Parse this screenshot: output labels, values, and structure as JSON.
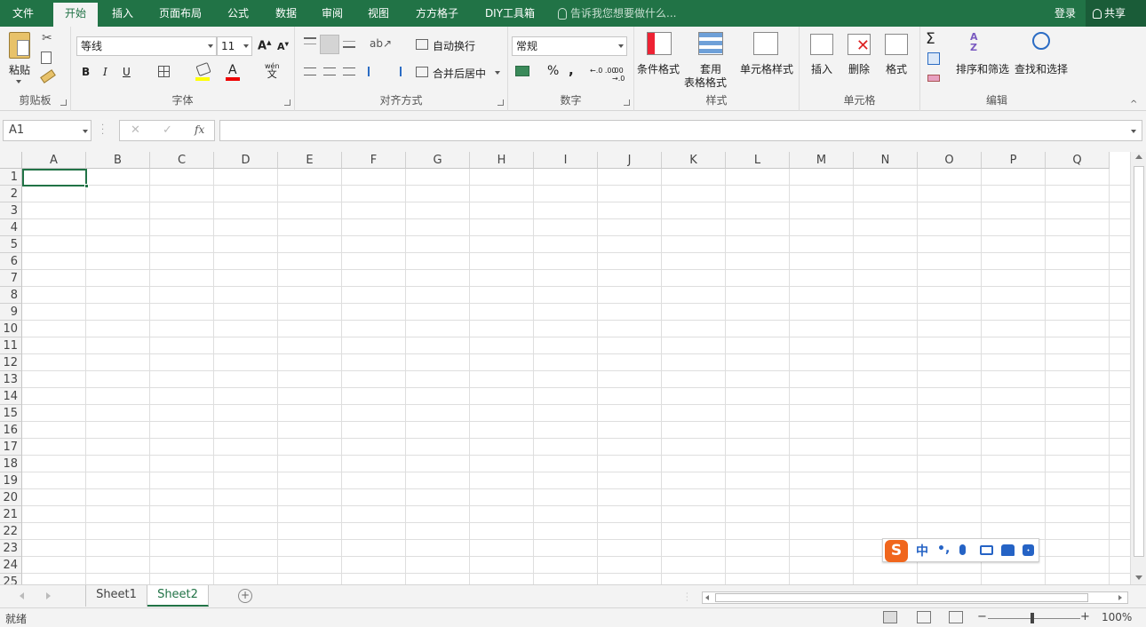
{
  "tabs": [
    {
      "label": "文件"
    },
    {
      "label": "开始"
    },
    {
      "label": "插入"
    },
    {
      "label": "页面布局"
    },
    {
      "label": "公式"
    },
    {
      "label": "数据"
    },
    {
      "label": "审阅"
    },
    {
      "label": "视图"
    },
    {
      "label": "方方格子"
    },
    {
      "label": "DIY工具箱"
    }
  ],
  "tellme": "告诉我您想要做什么...",
  "login": "登录",
  "share": "共享",
  "ribbon": {
    "clipboard": {
      "paste": "粘贴",
      "label": "剪贴板"
    },
    "font": {
      "name": "等线",
      "size": "11",
      "bold": "B",
      "italic": "I",
      "underline": "U",
      "label": "字体",
      "wen": "wén",
      "wen2": "文"
    },
    "align": {
      "wrap": "自动换行",
      "merge": "合并后居中",
      "label": "对齐方式"
    },
    "number": {
      "format": "常规",
      "percent": "%",
      "comma": ",",
      "label": "数字",
      "dec_inc": "←.0 .00",
      "dec_dec": ".00 →.0"
    },
    "styles": {
      "cond": "条件格式",
      "table1": "套用",
      "table2": "表格格式",
      "cell": "单元格样式",
      "label": "样式"
    },
    "cells": {
      "insert": "插入",
      "delete": "删除",
      "format": "格式",
      "label": "单元格"
    },
    "edit": {
      "sort": "排序和筛选",
      "find": "查找和选择",
      "label": "编辑"
    }
  },
  "formula": {
    "namebox": "A1",
    "fx": "fx",
    "cancel": "✕",
    "enter": "✓",
    "value": ""
  },
  "columns": [
    "A",
    "B",
    "C",
    "D",
    "E",
    "F",
    "G",
    "H",
    "I",
    "J",
    "K",
    "L",
    "M",
    "N",
    "O",
    "P",
    "Q"
  ],
  "rows": [
    "1",
    "2",
    "3",
    "4",
    "5",
    "6",
    "7",
    "8",
    "9",
    "10",
    "11",
    "12",
    "13",
    "14",
    "15",
    "16",
    "17",
    "18",
    "19",
    "20",
    "21",
    "22",
    "23",
    "24",
    "25"
  ],
  "ime": {
    "logo": "S",
    "lang": "中",
    "punct": "•,",
    "items": [
      "mic-icon",
      "keyboard-icon",
      "shirt-icon",
      "grid-icon"
    ]
  },
  "sheets": [
    {
      "label": "Sheet1",
      "active": false
    },
    {
      "label": "Sheet2",
      "active": true
    }
  ],
  "status": {
    "ready": "就绪",
    "zoom": "100%",
    "minus": "−",
    "plus": "+"
  },
  "colors": {
    "accent": "#217346"
  }
}
